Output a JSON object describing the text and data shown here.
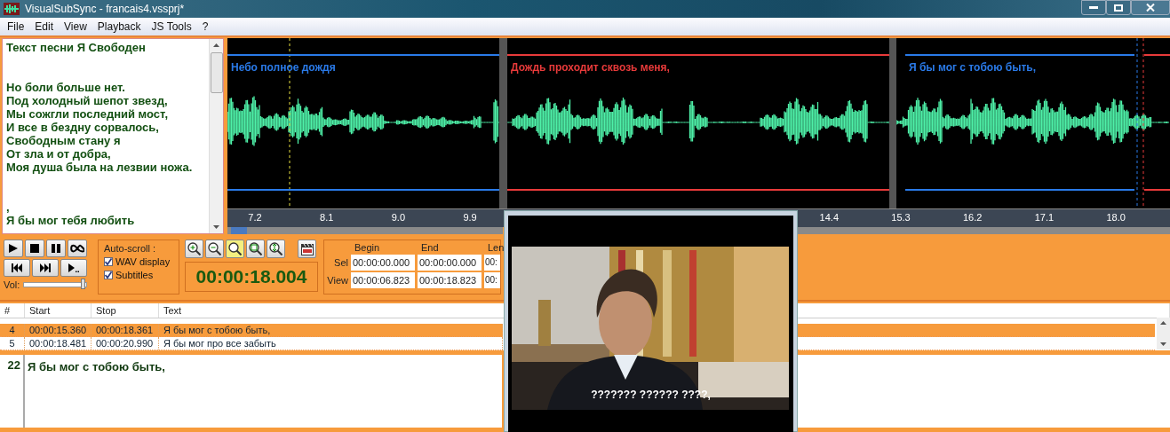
{
  "window": {
    "title": "VisualSubSync - francais4.vssprj*"
  },
  "menu": [
    "File",
    "Edit",
    "View",
    "Playback",
    "JS Tools",
    "?"
  ],
  "lyrics": {
    "title": "Текст песни Я Свободен",
    "stanzas": [
      [
        "Но боли больше нет.",
        "Под холодный шепот звезд,",
        "Мы сожгли последний мост,",
        "И все в бездну сорвалось,",
        "Свободным стану я",
        "От зла и от добра,",
        "Моя душа была на лезвии ножа."
      ],
      [
        ",",
        "Я бы мог тебя любить"
      ]
    ]
  },
  "waveform": {
    "segments": [
      {
        "label": "Небо полное дождя",
        "color": "#2a7ae8"
      },
      {
        "label": "Дождь проходит сквозь меня,",
        "color": "#e83a3a"
      },
      {
        "label": "Я бы мог с тобою быть,",
        "color": "#2a7ae8"
      }
    ],
    "ticks": [
      "7.2",
      "8.1",
      "9.0",
      "9.9",
      "14.4",
      "15.3",
      "16.2",
      "17.1",
      "18.0"
    ]
  },
  "toolbar": {
    "volume_label": "Vol:",
    "volume": {
      "level": 0.95
    },
    "autoscroll": {
      "label": "Auto-scroll :",
      "options": [
        {
          "label": "WAV display",
          "checked": true
        },
        {
          "label": "Subtitles",
          "checked": true
        }
      ]
    },
    "time": "00:00:18.004",
    "range": {
      "columns": [
        "Begin",
        "End",
        "Len"
      ],
      "rows": [
        {
          "label": "Sel",
          "values": [
            "00:00:00.000",
            "00:00:00.000",
            "00:"
          ]
        },
        {
          "label": "View",
          "values": [
            "00:00:06.823",
            "00:00:18.823",
            "00:"
          ]
        }
      ]
    }
  },
  "table": {
    "columns": [
      "#",
      "Start",
      "Stop",
      "Text"
    ],
    "rows": [
      {
        "index": "4",
        "start": "00:00:15.360",
        "stop": "00:00:18.361",
        "text": "Я бы мог с тобою быть,",
        "selected": true
      },
      {
        "index": "5",
        "start": "00:00:18.481",
        "stop": "00:00:20.990",
        "text": "Я бы мог про все забыть",
        "selected": false
      }
    ]
  },
  "editor": {
    "line": "22",
    "text": "Я бы мог с тобою быть,"
  },
  "video": {
    "subtitle": "??????? ?????? ????,"
  }
}
